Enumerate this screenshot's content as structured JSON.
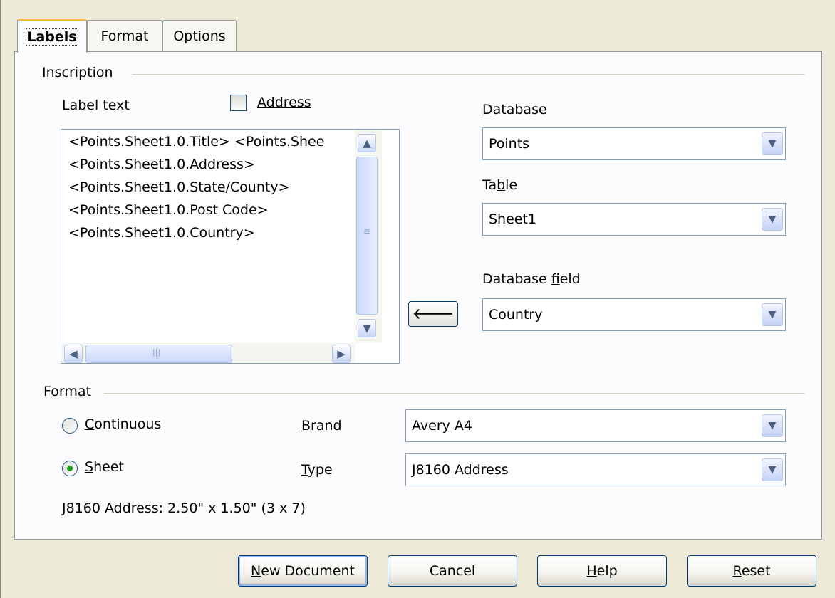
{
  "tabs": [
    {
      "label": "Labels",
      "active": true
    },
    {
      "label": "Format",
      "active": false
    },
    {
      "label": "Options",
      "active": false
    }
  ],
  "inscription": {
    "group_title": "Inscription",
    "label_text_label": "Label text",
    "address_label": "Address",
    "address_checked": false,
    "text_lines": [
      "<Points.Sheet1.0.Title> <Points.Shee",
      "<Points.Sheet1.0.Address>",
      "<Points.Sheet1.0.State/County>",
      "<Points.Sheet1.0.Post Code>",
      "<Points.Sheet1.0.Country>"
    ],
    "database_label": "Database",
    "database_value": "Points",
    "table_label": "Table",
    "table_value": "Sheet1",
    "database_field_label": "Database field",
    "database_field_value": "Country"
  },
  "format": {
    "group_title": "Format",
    "continuous_label": "Continuous",
    "sheet_label": "Sheet",
    "selected": "Sheet",
    "brand_label": "Brand",
    "brand_value": "Avery A4",
    "type_label": "Type",
    "type_value": "J8160 Address",
    "description": "J8160 Address: 2.50\" x 1.50\" (3 x 7)"
  },
  "buttons": {
    "new_document": "New Document",
    "cancel": "Cancel",
    "help": "Help",
    "reset": "Reset"
  },
  "icons": {
    "scroll_up": "▲",
    "scroll_down": "▼",
    "scroll_left": "◀",
    "scroll_right": "▶",
    "combo_arrow": "▼",
    "insert_arrow": "🡐"
  }
}
